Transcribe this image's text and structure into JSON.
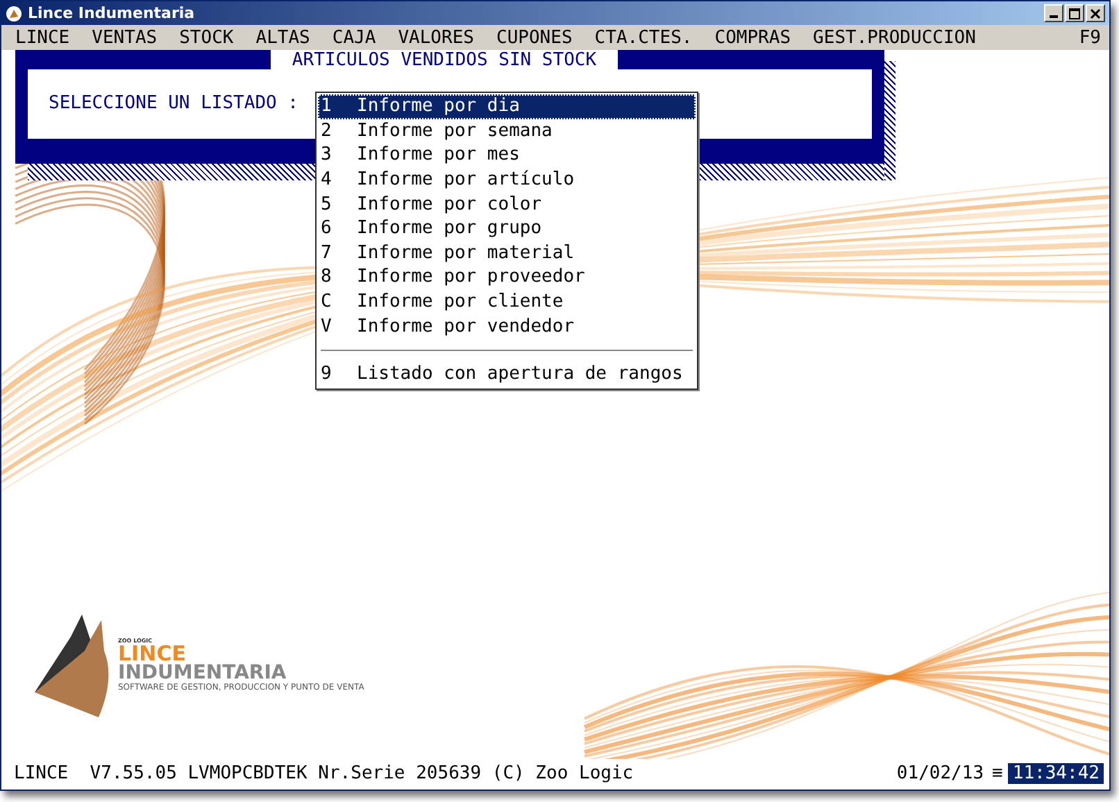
{
  "window": {
    "title": "Lince Indumentaria"
  },
  "menu": [
    {
      "label": "LINCE"
    },
    {
      "label": "VENTAS"
    },
    {
      "label": "STOCK"
    },
    {
      "label": "ALTAS"
    },
    {
      "label": "CAJA"
    },
    {
      "label": "VALORES"
    },
    {
      "label": "CUPONES"
    },
    {
      "label": "CTA.CTES."
    },
    {
      "label": "COMPRAS"
    },
    {
      "label": "GEST.PRODUCCION"
    }
  ],
  "menu_shortcut": "F9",
  "dialog": {
    "title": "ARTICULOS VENDIDOS SIN STOCK",
    "prompt": "SELECCIONE UN LISTADO :"
  },
  "list": [
    {
      "kind": "item",
      "key": "1",
      "label": "Informe por dia",
      "selected": true
    },
    {
      "kind": "item",
      "key": "2",
      "label": "Informe por semana",
      "selected": false
    },
    {
      "kind": "item",
      "key": "3",
      "label": "Informe por mes",
      "selected": false
    },
    {
      "kind": "item",
      "key": "4",
      "label": "Informe por artículo",
      "selected": false
    },
    {
      "kind": "item",
      "key": "5",
      "label": "Informe por color",
      "selected": false
    },
    {
      "kind": "item",
      "key": "6",
      "label": "Informe por grupo",
      "selected": false
    },
    {
      "kind": "item",
      "key": "7",
      "label": "Informe por material",
      "selected": false
    },
    {
      "kind": "item",
      "key": "8",
      "label": "Informe por proveedor",
      "selected": false
    },
    {
      "kind": "item",
      "key": "C",
      "label": "Informe por cliente",
      "selected": false
    },
    {
      "kind": "item",
      "key": "V",
      "label": "Informe por vendedor",
      "selected": false
    },
    {
      "kind": "separator"
    },
    {
      "kind": "item",
      "key": "9",
      "label": "Listado con apertura de rangos",
      "selected": false
    }
  ],
  "logo": {
    "brand": "ZOO LOGIC",
    "name": "LINCE",
    "subname": "INDUMENTARIA",
    "tagline": "SOFTWARE DE GESTION, PRODUCCION Y PUNTO DE VENTA"
  },
  "status_bar": {
    "info": "LINCE  V7.55.05 LVMOPCBDTEK Nr.Serie 205639 (C) Zoo Logic",
    "date": "01/02/13",
    "separator": "≡",
    "time": "11:34:42"
  }
}
